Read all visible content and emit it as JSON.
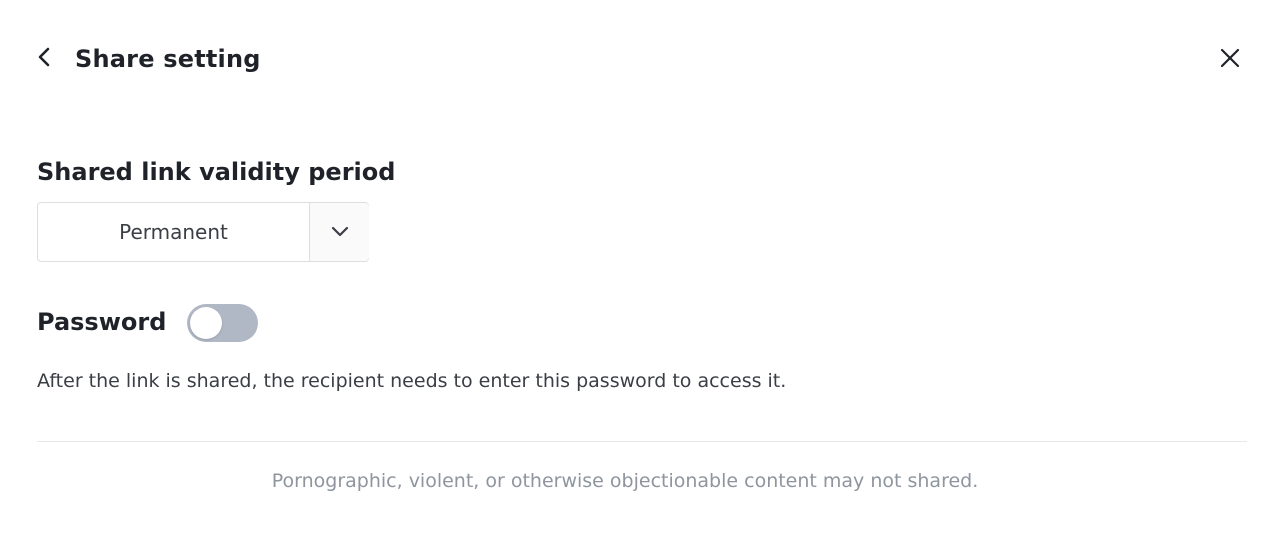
{
  "header": {
    "back_icon": "chevron-left-icon",
    "title": "Share setting",
    "close_icon": "close-icon"
  },
  "validity": {
    "label": "Shared link validity period",
    "selected_value": "Permanent",
    "dropdown_icon": "chevron-down-icon"
  },
  "password": {
    "label": "Password",
    "enabled": false,
    "hint": "After the link is shared, the recipient needs to enter this password to access it."
  },
  "footer": {
    "note": "Pornographic, violent, or otherwise objectionable content may not shared."
  },
  "colors": {
    "toggle_off": "#b1b8c5",
    "text_primary": "#1f2329",
    "text_muted": "#8f959e"
  }
}
